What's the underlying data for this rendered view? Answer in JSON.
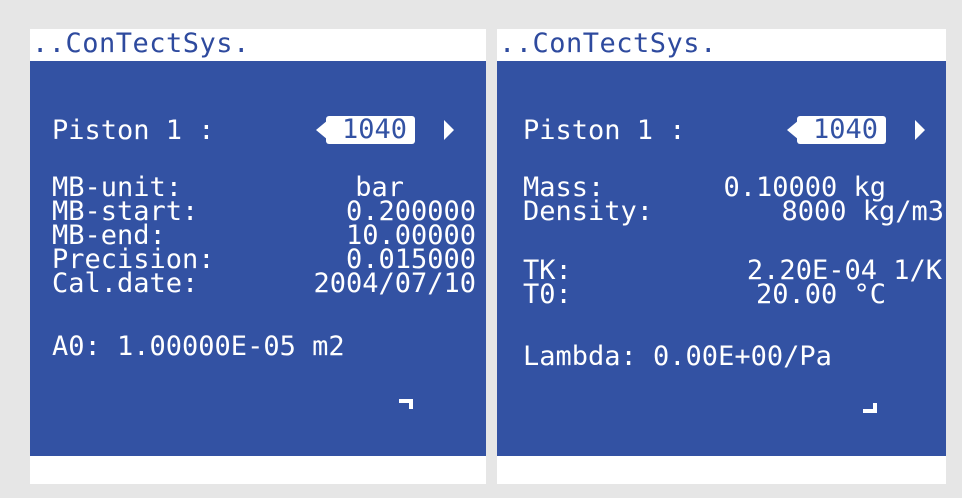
{
  "left": {
    "title": "..ConTectSys.",
    "piston_label": "Piston 1 :",
    "piston_value": "1040",
    "rows": [
      {
        "label": "MB-unit:",
        "value": "bar"
      },
      {
        "label": "MB-start:",
        "value": "0.200000"
      },
      {
        "label": "MB-end:",
        "value": "10.00000"
      },
      {
        "label": "Precision:",
        "value": "0.015000"
      },
      {
        "label": "Cal.date:",
        "value": "2004/07/10"
      }
    ],
    "area_line": "A0: 1.00000E-05 m2",
    "corner_icon": "return-down-left-icon"
  },
  "right": {
    "title": "..ConTectSys.",
    "piston_label": "Piston 1 :",
    "piston_value": "1040",
    "mass_label": "Mass:",
    "mass_value": "0.10000 kg",
    "density_label": "Density:",
    "density_value": "8000 kg/m3",
    "tk_label": "TK:",
    "tk_value": "2.20E-04 1/K",
    "t0_label": "T0:",
    "t0_value": "20.00 °C",
    "lambda_line": "Lambda: 0.00E+00/Pa",
    "corner_icon": "return-up-left-icon"
  },
  "colors": {
    "panel": "#3352a3",
    "title_text": "#2e4a9e",
    "background": "#e6e6e6"
  }
}
